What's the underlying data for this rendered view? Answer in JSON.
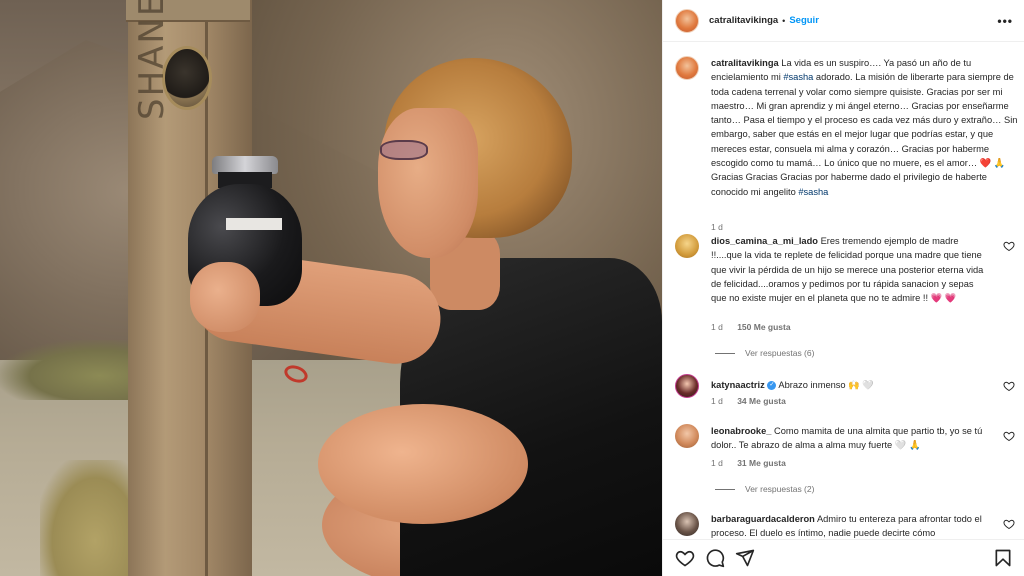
{
  "post": {
    "username": "catralitavikinga",
    "separator": "•",
    "follow_label": "Seguir",
    "more_icon": "more-horizontal-icon",
    "caption_pre": "La vida es un suspiro…. Ya pasó un año de tu encielamiento mi ",
    "caption_tag1": "#sasha",
    "caption_mid": " adorado. La misión de liberarte para siempre de toda cadena terrenal y volar como siempre quisiste. Gracias por ser mi maestro… Mi gran aprendiz y mi ángel eterno… Gracias por enseñarme tanto… Pasa el tiempo y el proceso es cada vez más duro y extraño… Sin embargo, saber que estás en el mejor lugar que podrías estar, y que mereces estar, consuela mi alma y corazón… Gracias por haberme escogido como tu mamá… Lo único que no muere, es el amor… ❤️ 🙏 Gracias Gracias Gracias por haberme dado el privilegio de haberte conocido mi angelito ",
    "caption_tag2": "#sasha",
    "time": "1 d"
  },
  "comments": [
    {
      "username": "dios_camina_a_mi_lado",
      "text": "Eres tremendo ejemplo de madre !!....que la vida te replete de felicidad porque una madre que tiene que vivir la pérdida de un hijo se merece una posterior eterna vida de felicidad....oramos y pedimos por tu rápida sanacion y sepas que no existe mujer en el planeta que no te admire !! 💗 💗",
      "time": "1 d",
      "likes": "150 Me gusta",
      "replies": "Ver respuestas (6)"
    },
    {
      "username": "katynaactriz",
      "text": "Abrazo inmenso 🙌 🤍",
      "time": "1 d",
      "likes": "34 Me gusta",
      "verified": true
    },
    {
      "username": "leonabrooke_",
      "text": "Como mamita de una almita que partio tb, yo se tú dolor.. Te abrazo de alma a alma muy fuerte 🤍 🙏",
      "time": "1 d",
      "likes": "31 Me gusta",
      "replies": "Ver respuestas (2)"
    },
    {
      "username": "barbaraguardacalderon",
      "text": "Admiro tu entereza para afrontar todo el proceso. El duelo es íntimo, nadie puede decirte cómo"
    }
  ],
  "photo": {
    "carving_text": "SHANE",
    "description_alt": ""
  },
  "actions": [
    "heart-icon",
    "comment-icon",
    "share-icon",
    "bookmark-icon"
  ],
  "colors": {
    "link": "#0095f6",
    "hashtag": "#00376b",
    "muted": "#737373",
    "text": "#262626"
  }
}
